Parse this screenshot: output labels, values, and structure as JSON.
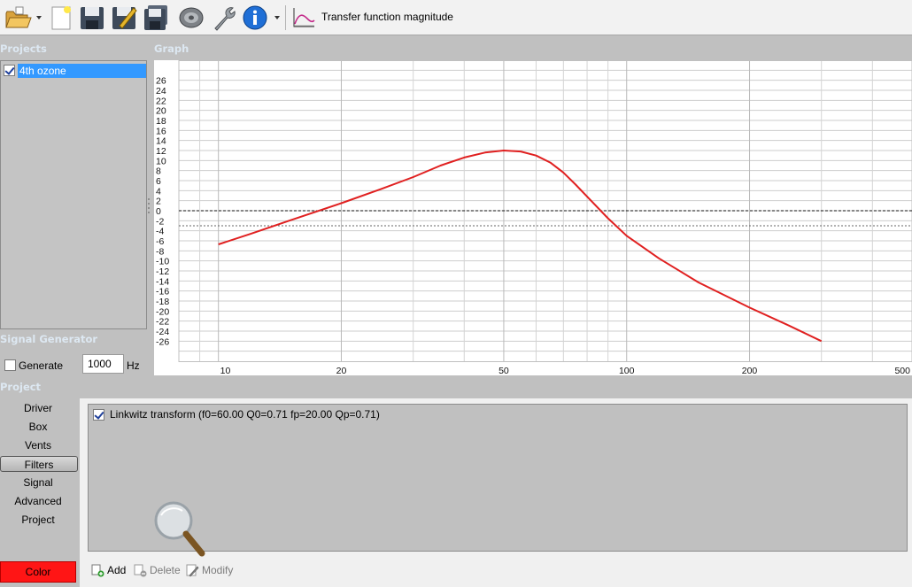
{
  "toolbar": {
    "title": "Transfer function magnitude",
    "icons": [
      "open-folder-icon",
      "new-document-icon",
      "save-icon",
      "save-as-icon",
      "save-all-icon",
      "speaker-icon",
      "wrench-icon",
      "info-icon",
      "chart-icon"
    ]
  },
  "projects": {
    "header": "Projects",
    "items": [
      {
        "label": "4th ozone",
        "checked": true
      }
    ]
  },
  "graph": {
    "header": "Graph"
  },
  "signal_generator": {
    "header": "Signal Generator",
    "generate_label": "Generate",
    "generate_checked": false,
    "frequency": "1000",
    "unit": "Hz"
  },
  "project": {
    "header": "Project",
    "nav": [
      "Driver",
      "Box",
      "Vents",
      "Filters",
      "Signal",
      "Advanced",
      "Project"
    ],
    "active": "Filters",
    "color_label": "Color",
    "color_value": "#ff1515"
  },
  "filters": {
    "items": [
      {
        "label": "Linkwitz transform (f0=60.00 Q0=0.71 fp=20.00 Qp=0.71)",
        "checked": true
      }
    ],
    "add_label": "Add",
    "delete_label": "Delete",
    "modify_label": "Modify"
  },
  "chart_data": {
    "type": "line",
    "xscale": "log",
    "xlim": [
      8,
      500
    ],
    "ylim": [
      -30,
      30
    ],
    "x_tick_labels": [
      10,
      20,
      50,
      100,
      200,
      500
    ],
    "y_tick_labels": [
      26,
      24,
      22,
      20,
      18,
      16,
      14,
      12,
      10,
      8,
      6,
      4,
      2,
      0,
      -2,
      -4,
      -6,
      -8,
      -10,
      -12,
      -14,
      -16,
      -18,
      -20,
      -22,
      -24,
      -26
    ],
    "grid": true,
    "reference_lines": [
      0,
      -3
    ],
    "series": [
      {
        "color": "#e02020",
        "x": [
          10,
          12,
          15,
          20,
          25,
          30,
          35,
          40,
          45,
          50,
          55,
          60,
          65,
          70,
          75,
          80,
          90,
          100,
          120,
          150,
          200,
          250,
          300
        ],
        "y": [
          -6.7,
          -4.6,
          -1.9,
          1.5,
          4.3,
          6.7,
          9.0,
          10.6,
          11.6,
          12.0,
          11.8,
          11.0,
          9.6,
          7.6,
          5.2,
          2.8,
          -1.5,
          -5.0,
          -9.5,
          -14.3,
          -19.3,
          -22.9,
          -26.0
        ]
      }
    ]
  }
}
